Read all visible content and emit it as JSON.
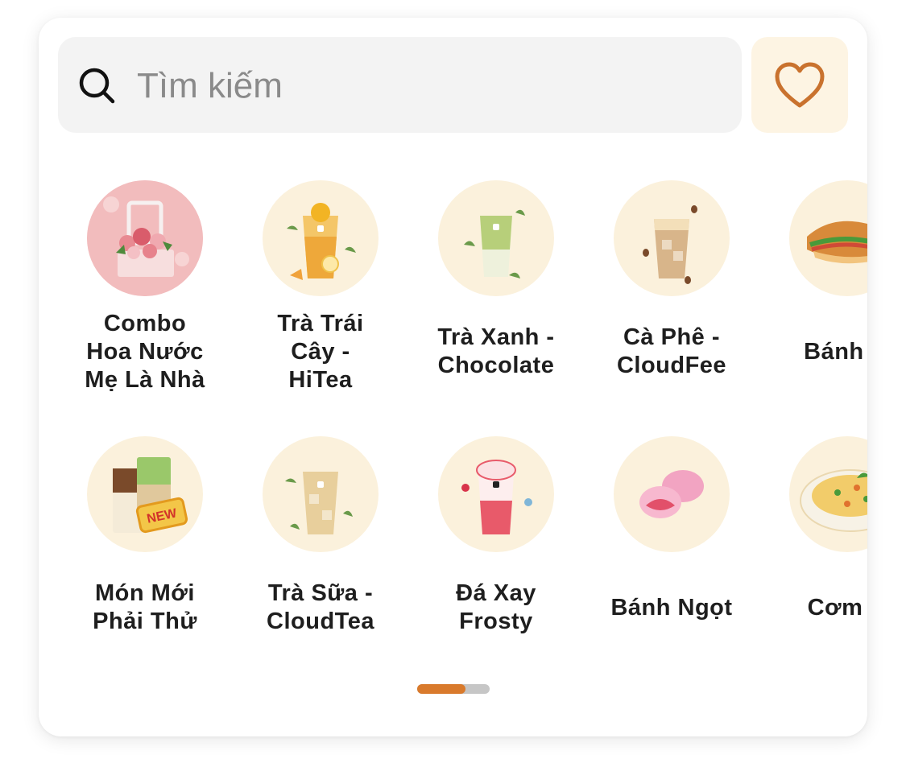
{
  "search": {
    "placeholder": "Tìm kiếm"
  },
  "favorites": {
    "icon": "heart-icon",
    "color": "#c9722e"
  },
  "categories": [
    {
      "label": "Combo\nHoa Nước\nMẹ Là Nhà",
      "icon": "flower-basket-icon"
    },
    {
      "label": "Trà Trái\nCây -\nHiTea",
      "icon": "fruit-tea-icon"
    },
    {
      "label": "Trà Xanh -\nChocolate",
      "icon": "green-tea-icon"
    },
    {
      "label": "Cà Phê -\nCloudFee",
      "icon": "coffee-icon"
    },
    {
      "label": "Bánh M",
      "icon": "banh-mi-icon"
    },
    {
      "label": "Món Mới\nPhải Thử",
      "icon": "new-drinks-icon"
    },
    {
      "label": "Trà Sữa -\nCloudTea",
      "icon": "milk-tea-icon"
    },
    {
      "label": "Đá Xay\nFrosty",
      "icon": "frosty-icon"
    },
    {
      "label": "Bánh Ngọt",
      "icon": "mochi-icon"
    },
    {
      "label": "Cơm N",
      "icon": "fried-rice-icon"
    }
  ],
  "pagination": {
    "pages": 2,
    "current": 1,
    "active_color": "#d97a2c",
    "track_color": "#c6c6c6"
  }
}
